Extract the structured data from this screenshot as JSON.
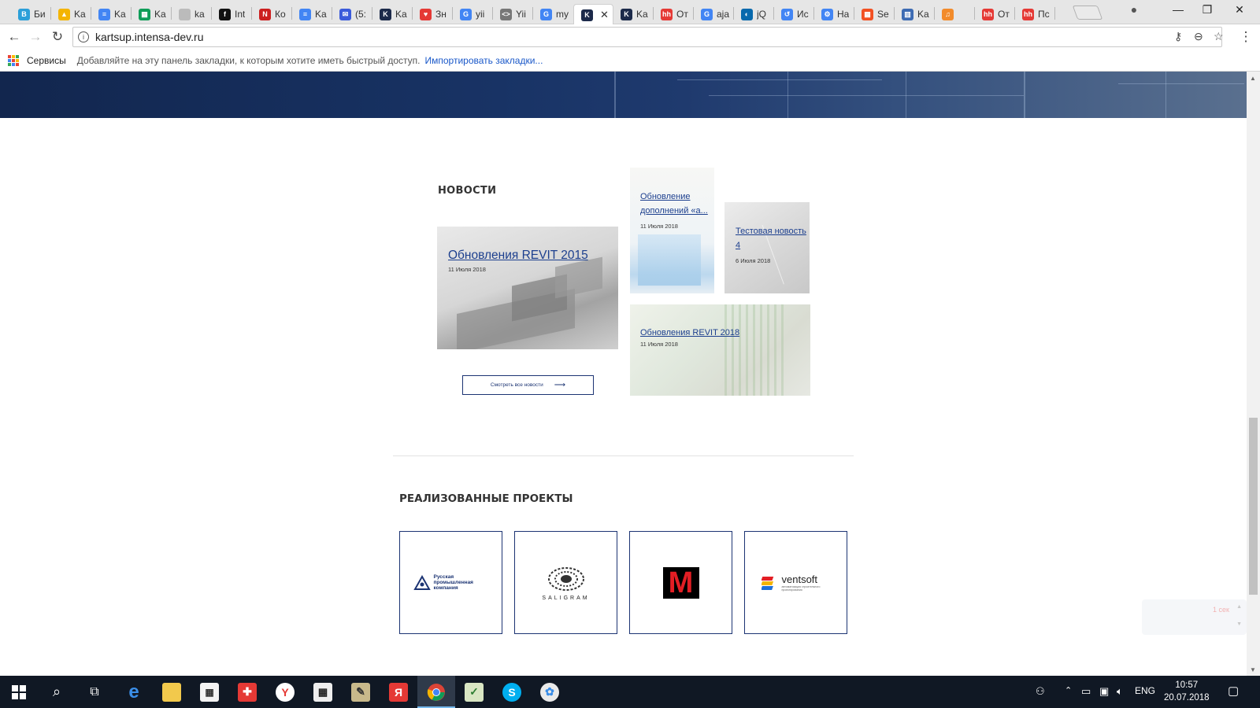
{
  "tabs": [
    {
      "title": "Би",
      "color": "#2b9fd9",
      "glyph": "B"
    },
    {
      "title": "Ka",
      "color": "#f4b400",
      "glyph": "▲"
    },
    {
      "title": "Ka",
      "color": "#4285f4",
      "glyph": "≡"
    },
    {
      "title": "Ka",
      "color": "#0f9d58",
      "glyph": "▦"
    },
    {
      "title": "ka",
      "color": "#bbbbbb",
      "glyph": ""
    },
    {
      "title": "Int",
      "color": "#111111",
      "glyph": "f"
    },
    {
      "title": "Ко",
      "color": "#cc1f1f",
      "glyph": "N"
    },
    {
      "title": "Ka",
      "color": "#4285f4",
      "glyph": "≡"
    },
    {
      "title": "(5:",
      "color": "#3b5bdb",
      "glyph": "✉"
    },
    {
      "title": "Ka",
      "color": "#1c2a4a",
      "glyph": "K"
    },
    {
      "title": "Зн",
      "color": "#e53935",
      "glyph": "♥"
    },
    {
      "title": "yii",
      "color": "#4285f4",
      "glyph": "G"
    },
    {
      "title": "Yii",
      "color": "#777777",
      "glyph": "<>"
    },
    {
      "title": "my",
      "color": "#4285f4",
      "glyph": "G"
    },
    {
      "title": "",
      "color": "#1c2a4a",
      "glyph": "K",
      "active": true
    },
    {
      "title": "Ka",
      "color": "#1c2a4a",
      "glyph": "K"
    },
    {
      "title": "От",
      "color": "#e53935",
      "glyph": "hh"
    },
    {
      "title": "aja",
      "color": "#4285f4",
      "glyph": "G"
    },
    {
      "title": "jQ",
      "color": "#0769ad",
      "glyph": "◐"
    },
    {
      "title": "Ис",
      "color": "#4285f4",
      "glyph": "↺"
    },
    {
      "title": "На",
      "color": "#4285f4",
      "glyph": "⚙"
    },
    {
      "title": "Se",
      "color": "#f25022",
      "glyph": "▦"
    },
    {
      "title": "Ka",
      "color": "#3d6bb3",
      "glyph": "▥"
    },
    {
      "title": "",
      "color": "#f28b2b",
      "glyph": "♫"
    },
    {
      "title": "От",
      "color": "#e53935",
      "glyph": "hh"
    },
    {
      "title": "Пс",
      "color": "#e53935",
      "glyph": "hh"
    }
  ],
  "address": {
    "url": "kartsup.intensa-dev.ru"
  },
  "bookmarks": {
    "apps_label": "Сервисы",
    "hint": "Добавляйте на эту панель закладки, к которым хотите иметь быстрый доступ.",
    "import_link": "Импортировать закладки..."
  },
  "news": {
    "heading": "НОВОСТИ",
    "items": [
      {
        "title": "Обновления REVIT 2015",
        "date": "11 Июля 2018"
      },
      {
        "title": "Обновление дополнений «а...",
        "date": "11 Июля 2018"
      },
      {
        "title": "Тестовая новость 4",
        "date": "6 Июля 2018"
      },
      {
        "title": "Обновления REVIT 2018",
        "date": "11 Июля 2018"
      }
    ],
    "all_button": "Смотреть все новости"
  },
  "projects": {
    "heading": "РЕАЛИЗОВАННЫЕ ПРОЕКТЫ",
    "items": [
      {
        "logo_text": "Русская промышленная компания",
        "logo_label": "Русская\nпромышленная\nкомпания"
      },
      {
        "logo_text": "SALIGRAM",
        "logo_label": "SALIGRAM"
      },
      {
        "logo_text": "M",
        "logo_label": "M"
      },
      {
        "logo_text": "ventsoft",
        "logo_label": "ventsoft",
        "logo_sub": "автоматизация строительного проектирования"
      }
    ]
  },
  "widget": {
    "text": "1 сек"
  },
  "taskbar": {
    "apps": [
      "start",
      "search",
      "task-view",
      "edge",
      "explorer",
      "store",
      "gift",
      "yandex-browser",
      "calculator",
      "notepad",
      "yandex",
      "chrome",
      "sheet",
      "skype",
      "paint"
    ],
    "lang": "ENG",
    "time": "10:57",
    "date": "20.07.2018"
  },
  "colors": {
    "accent": "#1c3473",
    "link": "#1c3f8e",
    "taskbar": "#101824"
  }
}
